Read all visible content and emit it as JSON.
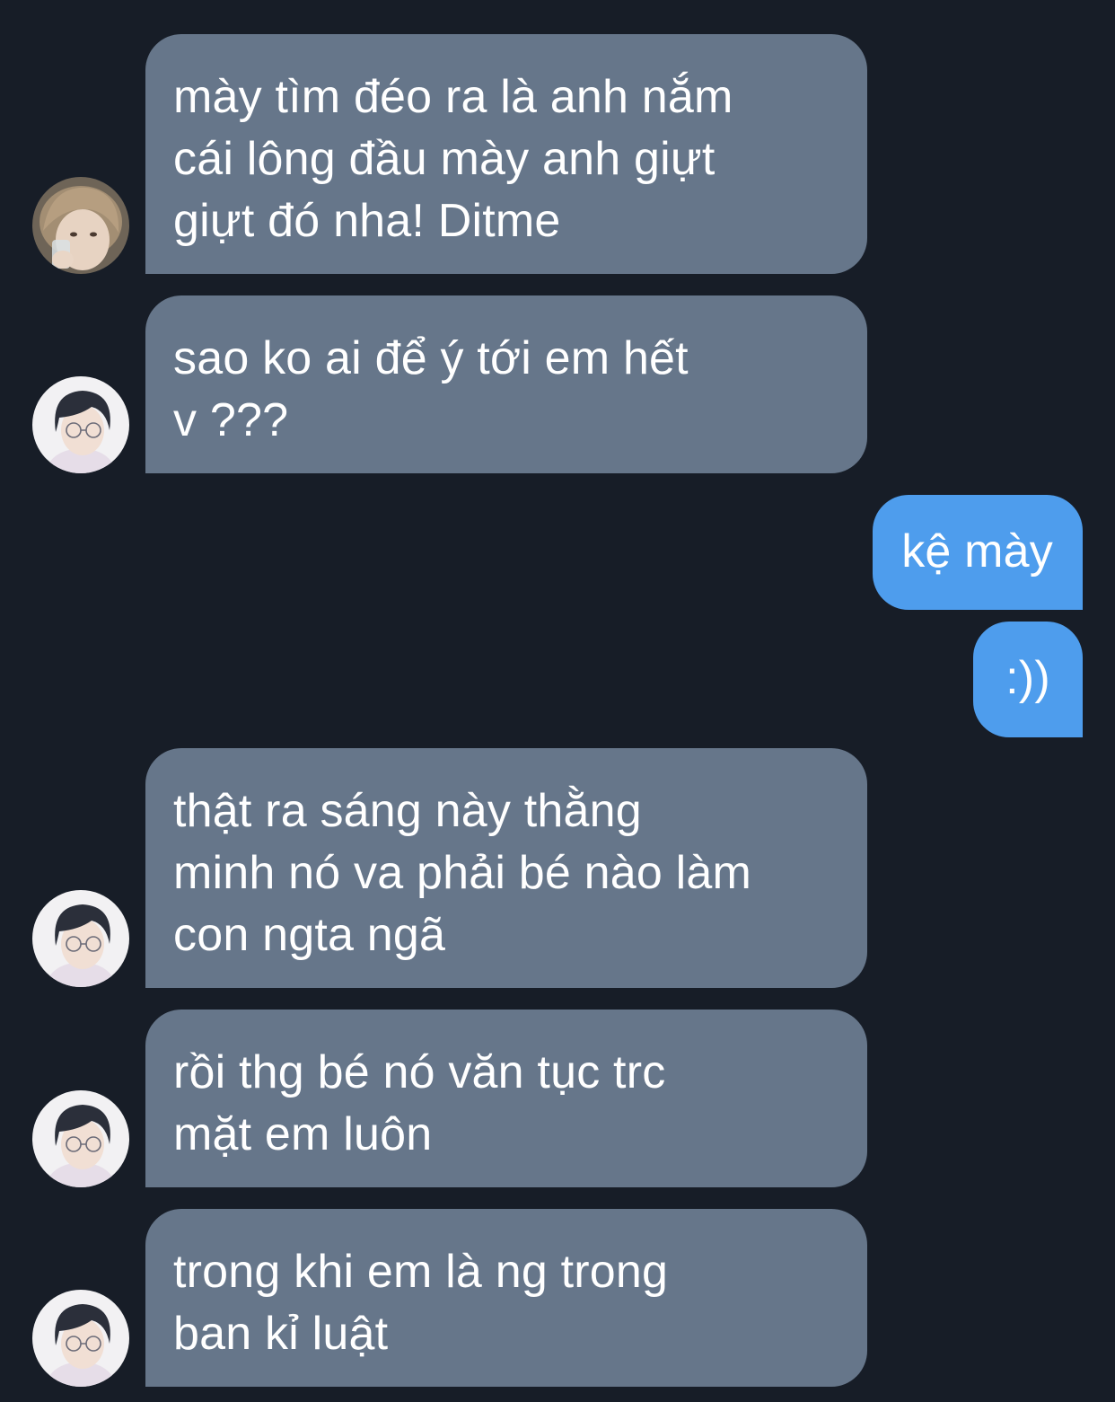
{
  "conversation": {
    "messages": [
      {
        "sender": "other",
        "avatar": "avatar-blond-drinking",
        "text": "mày tìm đéo ra là anh nắm\ncái lông đầu mày anh giựt\ngiựt đó nha! Ditme"
      },
      {
        "sender": "other",
        "avatar": "avatar-dark-hair-glasses",
        "text": "sao ko ai để ý tới em hết\nv ???"
      },
      {
        "sender": "self",
        "text": "kệ mày"
      },
      {
        "sender": "self",
        "text": ":))"
      },
      {
        "sender": "other",
        "avatar": "avatar-dark-hair-glasses",
        "text": "thật ra sáng này thằng\nminh nó va phải bé nào làm\ncon ngta ngã"
      },
      {
        "sender": "other",
        "avatar": "avatar-dark-hair-glasses",
        "text": "rồi thg bé nó văn tục trc\nmặt em luôn"
      },
      {
        "sender": "other",
        "avatar": "avatar-dark-hair-glasses",
        "text": "trong khi em là ng trong\nban kỉ luật"
      }
    ]
  },
  "colors": {
    "background": "#171d27",
    "incoming_bubble": "#66768a",
    "outgoing_bubble": "#4e9ded",
    "text": "#ffffff"
  }
}
